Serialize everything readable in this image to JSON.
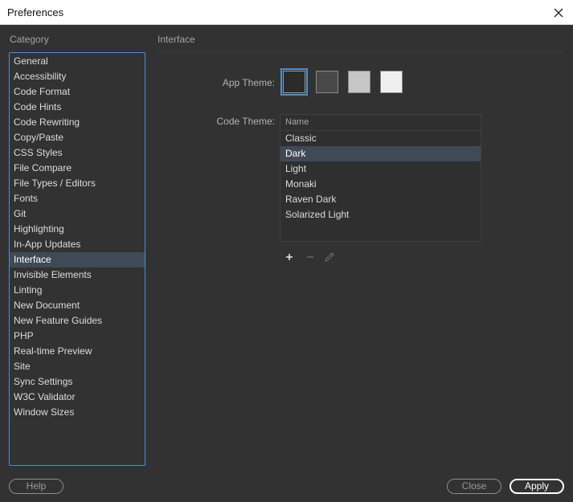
{
  "window": {
    "title": "Preferences"
  },
  "category": {
    "label": "Category",
    "selected": "Interface",
    "items": [
      "General",
      "Accessibility",
      "Code Format",
      "Code Hints",
      "Code Rewriting",
      "Copy/Paste",
      "CSS Styles",
      "File Compare",
      "File Types / Editors",
      "Fonts",
      "Git",
      "Highlighting",
      "In-App Updates",
      "Interface",
      "Invisible Elements",
      "Linting",
      "New Document",
      "New Feature Guides",
      "PHP",
      "Real-time Preview",
      "Site",
      "Sync Settings",
      "W3C Validator",
      "Window Sizes"
    ]
  },
  "panel": {
    "heading": "Interface",
    "app_theme": {
      "label": "App Theme:",
      "swatches": [
        {
          "name": "darkest",
          "color": "#2b2b2b",
          "selected": true
        },
        {
          "name": "dark",
          "color": "#484848",
          "selected": false
        },
        {
          "name": "light",
          "color": "#c6c6c6",
          "selected": false
        },
        {
          "name": "lightest",
          "color": "#efefef",
          "selected": false
        }
      ]
    },
    "code_theme": {
      "label": "Code Theme:",
      "column_header": "Name",
      "selected": "Dark",
      "items": [
        "Classic",
        "Dark",
        "Light",
        "Monaki",
        "Raven Dark",
        "Solarized Light"
      ]
    },
    "tools": [
      "add-icon",
      "remove-icon",
      "edit-icon"
    ]
  },
  "footer": {
    "help_label": "Help",
    "close_label": "Close",
    "apply_label": "Apply"
  },
  "colors": {
    "background": "#323232",
    "accent": "#4a8fd4",
    "selection": "#3f4a56"
  }
}
